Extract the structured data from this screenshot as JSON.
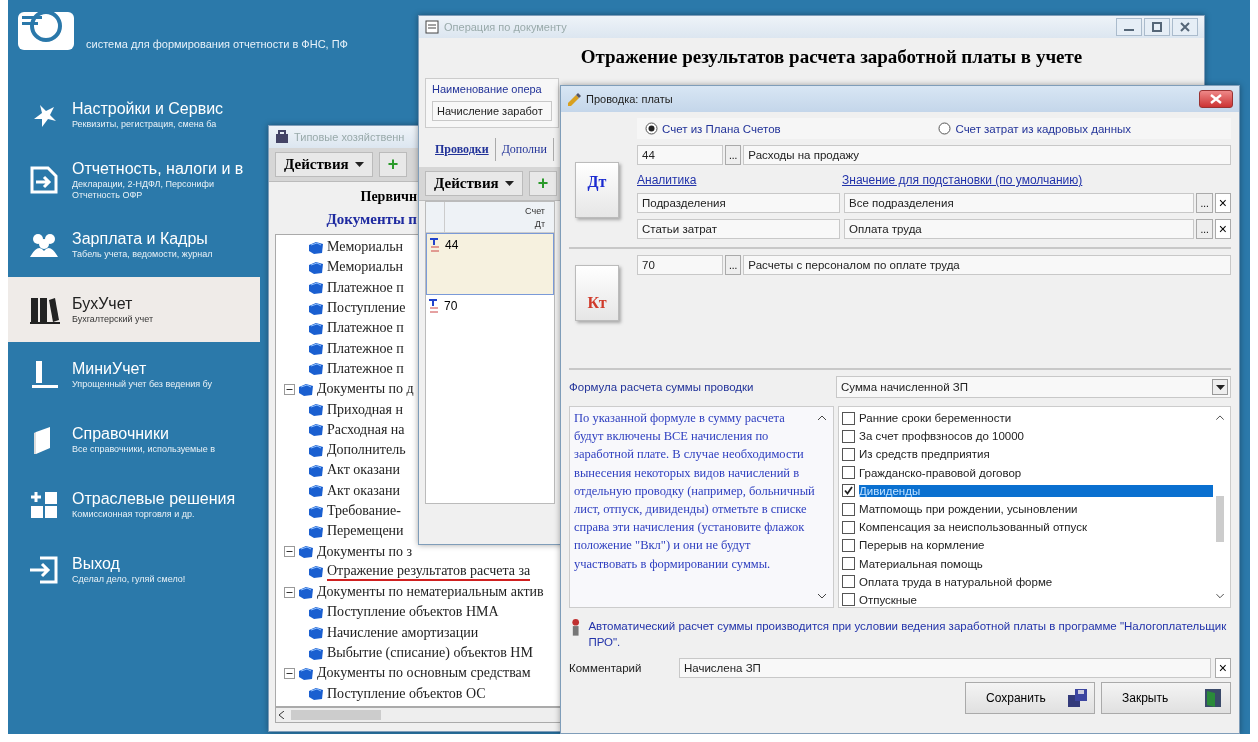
{
  "header": {
    "subtitle": "система для формирования отчетности в ФНС, ПФ"
  },
  "menu": [
    {
      "title": "Настройки и Сервис",
      "subtitle": [
        "Реквизиты, регистрация, смена ба"
      ],
      "selected": false
    },
    {
      "title": "Отчетность, налоги и в",
      "subtitle": [
        "Декларации, 2-НДФЛ, Персонифи",
        "Отчетность ОФР"
      ],
      "selected": false
    },
    {
      "title": "Зарплата и Кадры",
      "subtitle": [
        "Табель учета, ведомости, журнал"
      ],
      "selected": false
    },
    {
      "title": "БухУчет",
      "subtitle": [
        "Бухгалтерский учет"
      ],
      "selected": true
    },
    {
      "title": "МиниУчет",
      "subtitle": [
        "Упрощенный учет без ведения бу"
      ],
      "selected": false
    },
    {
      "title": "Справочники",
      "subtitle": [
        "Все справочники, используемые в"
      ],
      "selected": false
    },
    {
      "title": "Отраслевые решения",
      "subtitle": [
        "Комиссионная торговля и др."
      ],
      "selected": false
    },
    {
      "title": "Выход",
      "subtitle": [
        "Сделал дело, гуляй смело!"
      ],
      "selected": false
    }
  ],
  "templates_window": {
    "title": "Типовые хозяйственн",
    "actions": "Действия",
    "add": "+",
    "heading": "Первичн",
    "subheading": "Документы п",
    "tree_continued": [
      {
        "label": "Мемориальн"
      },
      {
        "label": "Мемориальн"
      },
      {
        "label": "Платежное п"
      },
      {
        "label": "Поступление"
      },
      {
        "label": "Платежное п"
      },
      {
        "label": "Платежное п"
      },
      {
        "label": "Платежное п"
      }
    ],
    "tree": [
      {
        "label": "Документы по д",
        "expanded": true,
        "children": [
          {
            "label": "Приходная н"
          },
          {
            "label": "Расходная на"
          },
          {
            "label": "Дополнитель"
          },
          {
            "label": "Акт оказани"
          },
          {
            "label": "Акт оказани"
          },
          {
            "label": "Требование-"
          },
          {
            "label": "Перемещени"
          }
        ]
      },
      {
        "label": "Документы по з",
        "expanded": true,
        "children": [
          {
            "label": "Отражение результатов расчета за",
            "marked": true
          }
        ]
      },
      {
        "label": "Документы по нематериальным актив",
        "expanded": true,
        "children": [
          {
            "label": "Поступление объектов НМА"
          },
          {
            "label": "Начисление амортизации"
          },
          {
            "label": "Выбытие (списание) объектов НМ"
          }
        ]
      },
      {
        "label": "Документы по основным средствам",
        "expanded": true,
        "children": [
          {
            "label": "Поступление объектов ОС"
          }
        ]
      }
    ]
  },
  "operation_window": {
    "title": "Операция по документу",
    "heading": "Отражение результатов расчета заработной платы в учете",
    "name_label": "Наименование опера",
    "name_value": "Начисление заработ",
    "tabs": [
      {
        "label": "Проводки",
        "selected": true
      },
      {
        "label": "Дополни",
        "selected": false
      }
    ],
    "actions": "Действия",
    "add": "+",
    "column_header": [
      "Счет",
      "Дт"
    ],
    "rows": [
      {
        "account": "44",
        "selected": true
      },
      {
        "account": "70",
        "selected": false
      }
    ]
  },
  "entry_window": {
    "title": "Проводка: платы",
    "source_options": [
      {
        "label": "Счет из Плана Счетов",
        "selected": true
      },
      {
        "label": "Счет затрат из кадровых данных",
        "selected": false
      }
    ],
    "debit": {
      "badge": "Дт",
      "account": "44",
      "browse": "...",
      "account_name": "Расходы на продажу",
      "analytics_header": "Аналитика",
      "value_header": "Значение для подстановки (по умолчанию)",
      "analytics": [
        {
          "name": "Подразделения",
          "value": "Все подразделения",
          "browse": "...",
          "clear": "×"
        },
        {
          "name": "Статьи затрат",
          "value": "Оплата труда",
          "browse": "...",
          "clear": "×"
        }
      ]
    },
    "credit": {
      "badge": "Кт",
      "account": "70",
      "browse": "...",
      "account_name": "Расчеты с персоналом по оплате труда"
    },
    "formula_label": "Формула расчета суммы проводки",
    "formula_value": "Сумма начисленной ЗП",
    "description": "По указанной формуле в сумму расчета будут включены ВСЕ начисления по заработной плате. В случае необходимости вынесения некоторых видов начислений в отдельную проводку (например, больничный лист, отпуск, дивиденды) отметьте в списке справа эти начисления (установите флажок положение \"Вкл\") и они не будут участвовать в формировании суммы.",
    "accruals": [
      {
        "label": "Ранние сроки беременности",
        "checked": false,
        "selected": false
      },
      {
        "label": "За счет профвзносов до 10000",
        "checked": false,
        "selected": false
      },
      {
        "label": "Из средств предприятия",
        "checked": false,
        "selected": false
      },
      {
        "label": "Гражданско-правовой договор",
        "checked": false,
        "selected": false
      },
      {
        "label": "Дивиденды",
        "checked": true,
        "selected": true
      },
      {
        "label": "Матпомощь при рождении, усыновлении",
        "checked": false,
        "selected": false
      },
      {
        "label": "Компенсация за неиспользованный отпуск",
        "checked": false,
        "selected": false
      },
      {
        "label": "Перерыв на кормление",
        "checked": false,
        "selected": false
      },
      {
        "label": "Материальная помощь",
        "checked": false,
        "selected": false
      },
      {
        "label": "Оплата труда в натуральной форме",
        "checked": false,
        "selected": false
      },
      {
        "label": "Отпускные",
        "checked": false,
        "selected": false
      }
    ],
    "note": "Автоматический расчет суммы производится при условии ведения заработной платы в программе \"Налогоплательщик ПРО\".",
    "comment_label": "Комментарий",
    "comment_value": "Начислена ЗП",
    "comment_clear": "×",
    "buttons": [
      {
        "label": "Сохранить",
        "kind": "save"
      },
      {
        "label": "Закрыть",
        "kind": "close"
      }
    ]
  }
}
